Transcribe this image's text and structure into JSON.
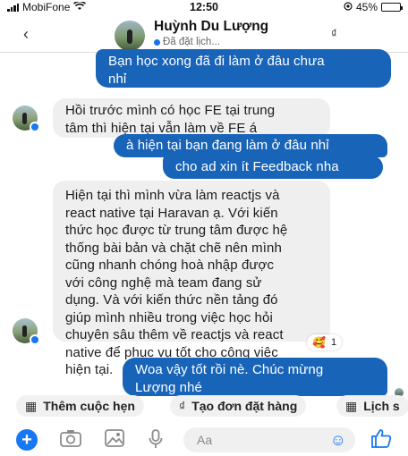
{
  "status_bar": {
    "carrier": "MobiFone",
    "time": "12:50",
    "battery_percent": "45%",
    "battery_level": 0.45,
    "icons": [
      "signal-icon",
      "wifi-icon",
      "location-icon",
      "battery-icon"
    ]
  },
  "header": {
    "contact_name": "Huỳnh Du Lượng",
    "contact_status": "Đã đặt lịch...",
    "right_icon_glyph": "₫",
    "back_glyph": "‹"
  },
  "messages": [
    {
      "direction": "outgoing",
      "lines": [
        "Bạn học xong đã đi làm ở đâu chưa",
        "nhỉ"
      ]
    },
    {
      "direction": "incoming",
      "lines": [
        "Hồi trước mình có học FE tại trung",
        "tâm thì hiện tại vẫn làm về FE á"
      ]
    },
    {
      "direction": "outgoing",
      "lines": [
        "à hiện tại bạn đang làm ở đâu nhỉ"
      ]
    },
    {
      "direction": "outgoing",
      "lines": [
        "cho ad xin ít Feedback nha"
      ]
    },
    {
      "direction": "incoming",
      "lines": [
        "Hiện tại thì mình vừa làm reactjs và",
        "react native tại Haravan ạ. Với kiến",
        "thức học được từ trung tâm được hệ",
        "thống bài bản và chặt chẽ nên mình",
        "cũng nhanh chóng hoà nhập được",
        "với công nghệ mà team đang sử",
        "dụng. Và với kiến thức nền tảng đó",
        "giúp mình nhiều trong việc học hỏi",
        "chuyên sâu thêm về reactjs và react",
        "native để phục vụ tốt cho công việc",
        "hiện tại."
      ]
    },
    {
      "direction": "outgoing",
      "lines": [
        "Woa vậy tốt rồi nè. Chúc mừng",
        "Lượng nhé"
      ]
    }
  ],
  "reaction": {
    "emoji": "🥰",
    "count": "1"
  },
  "quick_actions": [
    {
      "label": "Thêm cuộc hẹn",
      "icon": "calendar-icon",
      "glyph": "▦"
    },
    {
      "label": "Tạo đơn đặt hàng",
      "icon": "dong-icon",
      "glyph": "₫"
    },
    {
      "label": "Lịch s",
      "icon": "calendar-icon",
      "glyph": "▦"
    }
  ],
  "composer": {
    "placeholder": "Aa",
    "icons": {
      "plus": "+",
      "camera": "◎",
      "image": "▨",
      "mic": "🎤",
      "emoji": "☺",
      "like": "👍"
    }
  },
  "colors": {
    "outgoing_bubble": "#1864b8",
    "incoming_bubble": "#efefef",
    "accent": "#1877f2"
  }
}
